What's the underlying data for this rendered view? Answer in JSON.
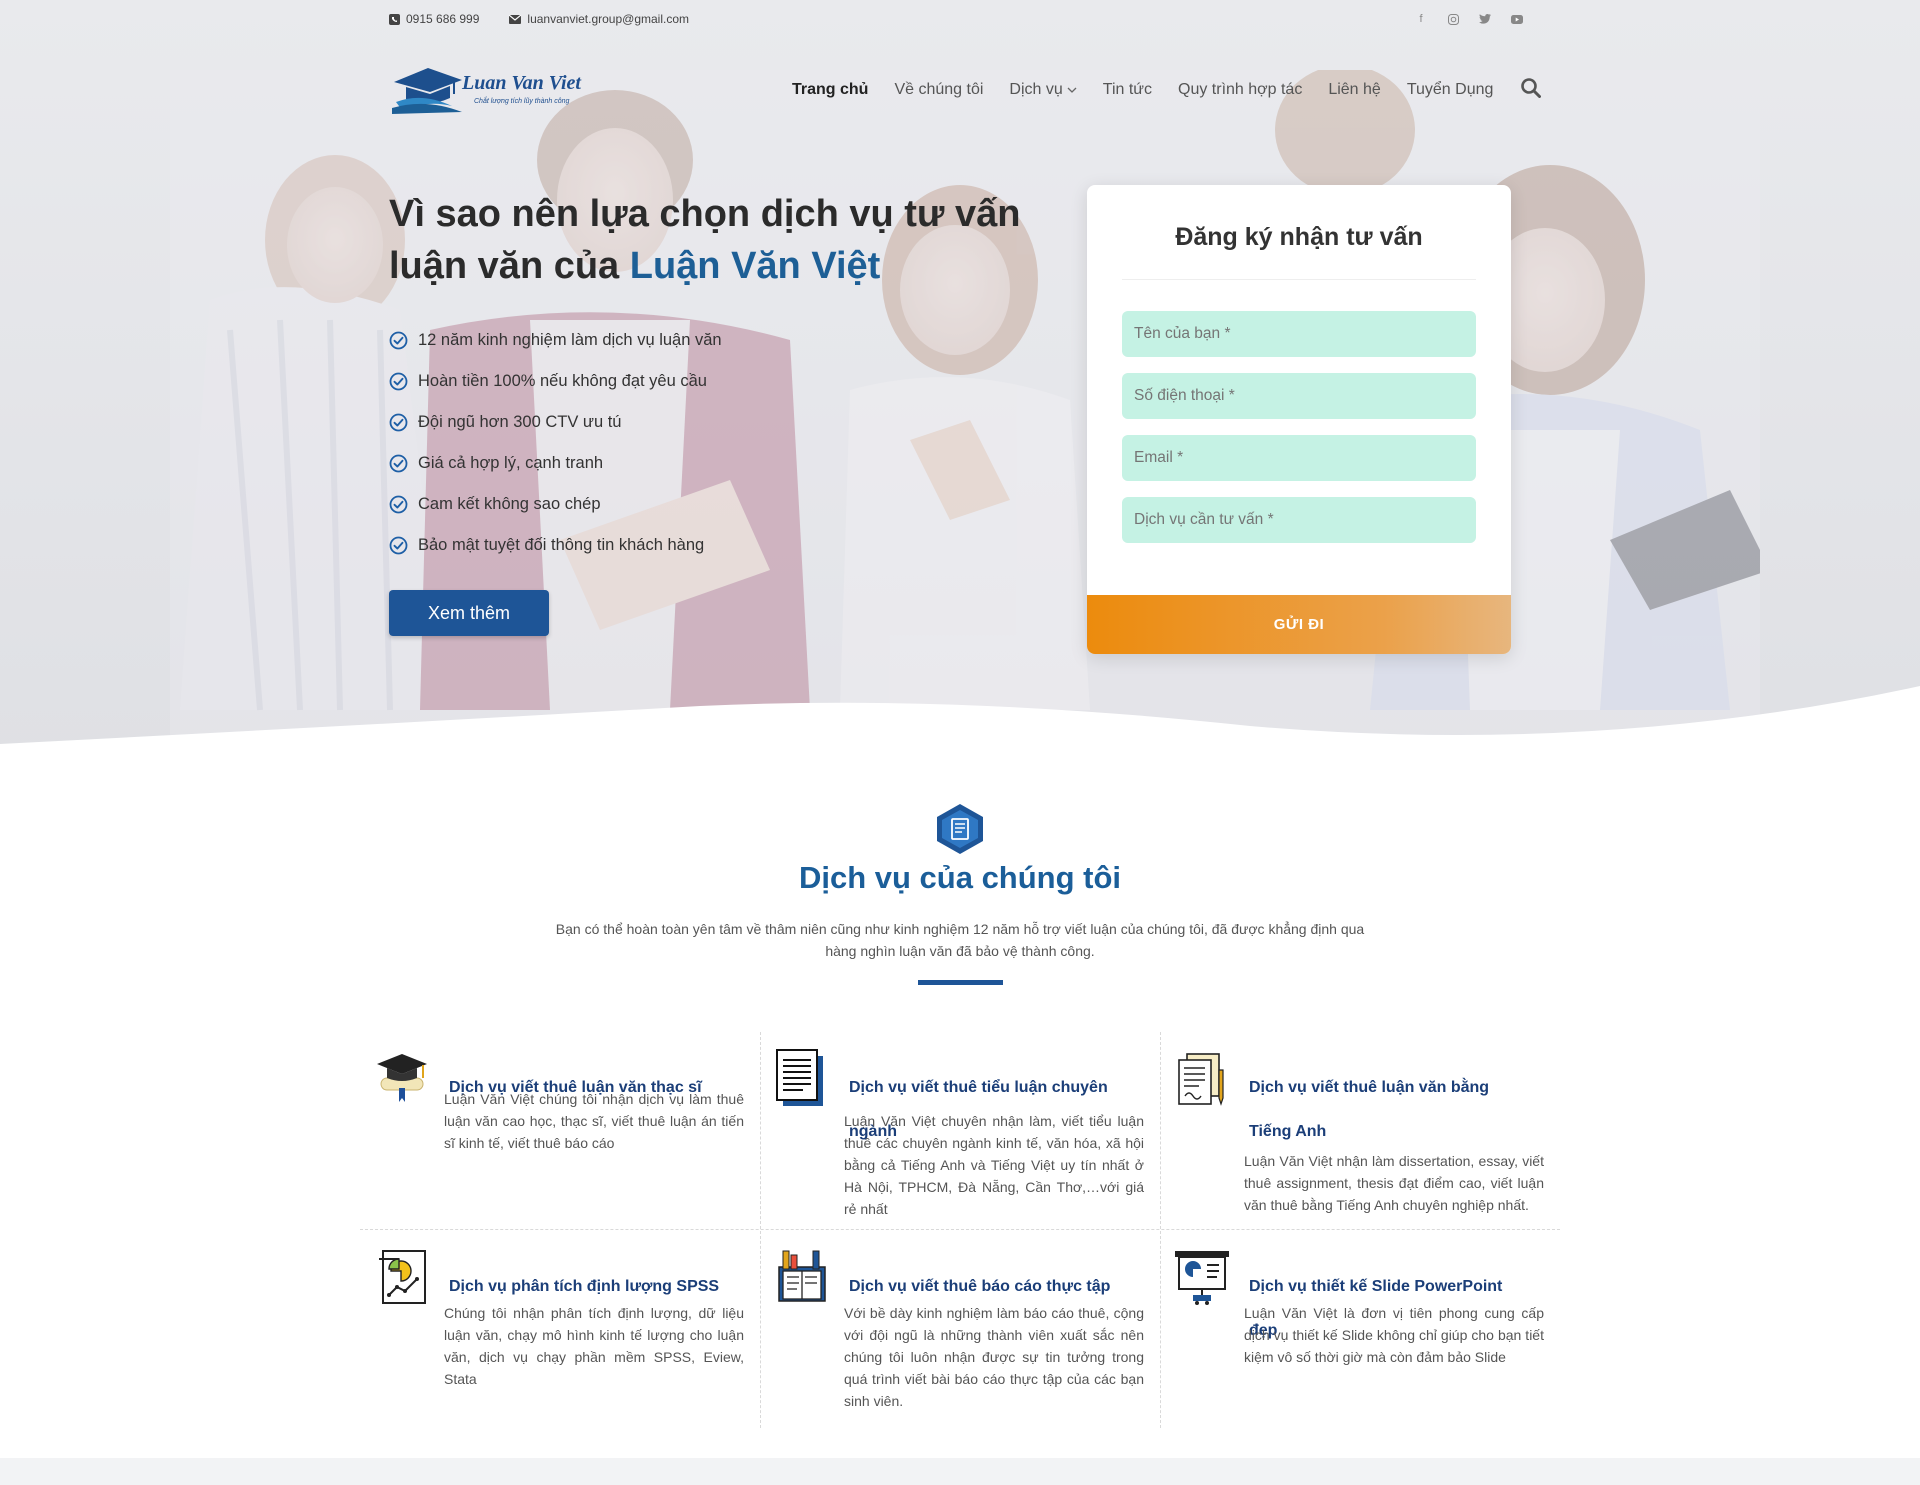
{
  "topbar": {
    "phone": "0915 686 999",
    "email": "luanvanviet.group@gmail.com"
  },
  "socials": [
    "facebook-icon",
    "instagram-icon",
    "twitter-icon",
    "youtube-icon"
  ],
  "logo": {
    "text": "Luan Van Viet",
    "tagline": "Chắt lượng tích lũy thành công"
  },
  "nav": {
    "items": [
      "Trang chủ",
      "Về chúng tôi",
      "Dịch vụ",
      "Tin tức",
      "Quy trình hợp tác",
      "Liên hệ",
      "Tuyển Dụng"
    ],
    "active_index": 0
  },
  "hero": {
    "title_part1": "Vì sao nên lựa chọn dịch vụ tư vấn luận văn của ",
    "title_brand": "Luận Văn Việt",
    "features": [
      "12 năm kinh nghiệm làm dịch vụ luận văn",
      "Hoàn tiền 100% nếu không đạt yêu cầu",
      "Đội ngũ hơn 300 CTV ưu tú",
      "Giá cả hợp lý, cạnh tranh",
      "Cam kết không sao chép",
      "Bảo mật tuyệt đối thông tin khách hàng"
    ],
    "button": "Xem thêm"
  },
  "form": {
    "title": "Đăng ký nhận tư vấn",
    "name_placeholder": "Tên của bạn *",
    "phone_placeholder": "Số điện thoại *",
    "email_placeholder": "Email *",
    "service_placeholder": "Dịch vụ cần tư vấn *",
    "submit": "GỬI ĐI"
  },
  "services": {
    "title": "Dịch vụ của chúng tôi",
    "description": "Bạn có thể hoàn toàn yên tâm về thâm niên cũng như kinh nghiệm 12 năm hỗ trợ viết luận của chúng tôi, đã được khẳng định qua hàng nghìn luận văn đã bảo vệ thành công.",
    "items": [
      {
        "title": "Dịch vụ viết thuê luận văn thạc sĩ",
        "text": "Luận Văn Việt chúng tôi nhận dịch vụ làm thuê luận văn cao học, thạc sĩ, viết thuê luận án tiến sĩ kinh tế, viết thuê báo cáo",
        "icon": "graduation-cap-icon"
      },
      {
        "title": "Dịch vụ viết thuê tiểu luận chuyên ngành",
        "text": "Luận Văn Việt chuyên nhận làm, viết tiểu luận thuê các chuyên ngành kinh tế, văn hóa, xã hội bằng cả Tiếng Anh và Tiếng Việt uy tín nhất ở Hà Nội, TPHCM, Đà Nẵng, Cần Thơ,…với giá rẻ nhất",
        "icon": "document-icon"
      },
      {
        "title": "Dịch vụ viết thuê luận văn bằng Tiếng Anh",
        "text": "Luận Văn Việt nhận làm dissertation, essay, viết thuê assignment, thesis đạt điểm cao, viết luận văn thuê bằng Tiếng Anh chuyên nghiệp nhất.",
        "icon": "papers-pen-icon"
      },
      {
        "title": "Dịch vụ phân tích định lượng SPSS",
        "text": "Chúng tôi nhận phân tích định lượng, dữ liệu luận văn, chạy mô hình kinh tế lượng cho luận văn, dịch vụ chạy phần mềm SPSS, Eview, Stata",
        "icon": "chart-report-icon"
      },
      {
        "title": "Dịch vụ viết thuê báo cáo thực tập",
        "text": "Với bề dày kinh nghiệm làm báo cáo thuê, cộng với đội ngũ là những thành viên xuất sắc nên chúng tôi luôn nhận được sự tin tưởng trong quá trình viết bài báo cáo thực tập của các bạn sinh viên.",
        "icon": "books-icon"
      },
      {
        "title": "Dịch vụ thiết kế Slide PowerPoint đẹp",
        "text": "Luận Văn Việt là đơn vị tiên phong cung cấp dịch vụ thiết kế Slide không chỉ giúp cho bạn tiết kiệm vô số thời giờ mà còn đảm bảo Slide",
        "icon": "presentation-icon"
      }
    ]
  },
  "colors": {
    "brand_blue": "#1e5597",
    "form_field": "#c5f2e4",
    "submit_orange": "#ec8b0d",
    "service_title": "#1b3e78"
  }
}
